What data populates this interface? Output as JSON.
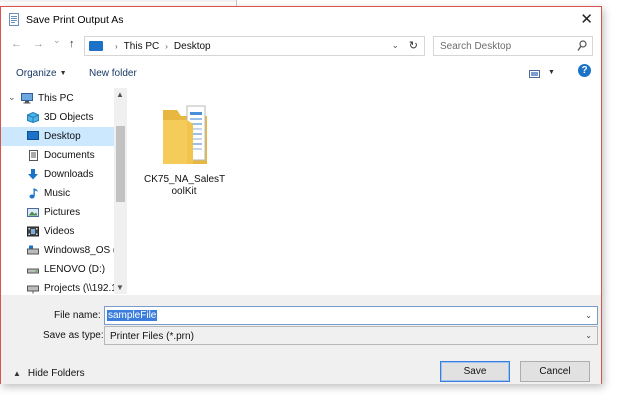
{
  "window": {
    "title": "Save Print Output As"
  },
  "nav": {
    "back": "←",
    "forward": "→",
    "recent": "⌄",
    "up": "↑",
    "breadcrumb": [
      "This PC",
      "Desktop"
    ],
    "search_placeholder": "Search Desktop"
  },
  "toolbar": {
    "organize": "Organize",
    "new_folder": "New folder",
    "help": "?"
  },
  "sidebar": {
    "items": [
      {
        "label": "This PC",
        "icon": "computer-icon"
      },
      {
        "label": "3D Objects",
        "icon": "cube-icon"
      },
      {
        "label": "Desktop",
        "icon": "desktop-icon",
        "selected": true
      },
      {
        "label": "Documents",
        "icon": "document-icon"
      },
      {
        "label": "Downloads",
        "icon": "download-arrow-icon"
      },
      {
        "label": "Music",
        "icon": "music-note-icon"
      },
      {
        "label": "Pictures",
        "icon": "picture-icon"
      },
      {
        "label": "Videos",
        "icon": "video-icon"
      },
      {
        "label": "Windows8_OS (C",
        "icon": "drive-icon"
      },
      {
        "label": "LENOVO (D:)",
        "icon": "drive-icon"
      },
      {
        "label": "Projects (\\\\192.16",
        "icon": "network-drive-icon"
      }
    ]
  },
  "files": [
    {
      "name": "CK75_NA_SalesToolKit",
      "name_line1": "CK75_NA_SalesT",
      "name_line2": "oolKit",
      "type": "folder"
    }
  ],
  "form": {
    "file_name_label": "File name:",
    "file_name_value": "sampleFile",
    "save_type_label": "Save as type:",
    "save_type_value": "Printer Files (*.prn)"
  },
  "footer": {
    "hide_folders": "Hide Folders",
    "save": "Save",
    "cancel": "Cancel"
  },
  "colors": {
    "accent": "#1a73c8",
    "selection": "#cce8ff",
    "dialog_border": "#d9534f"
  }
}
